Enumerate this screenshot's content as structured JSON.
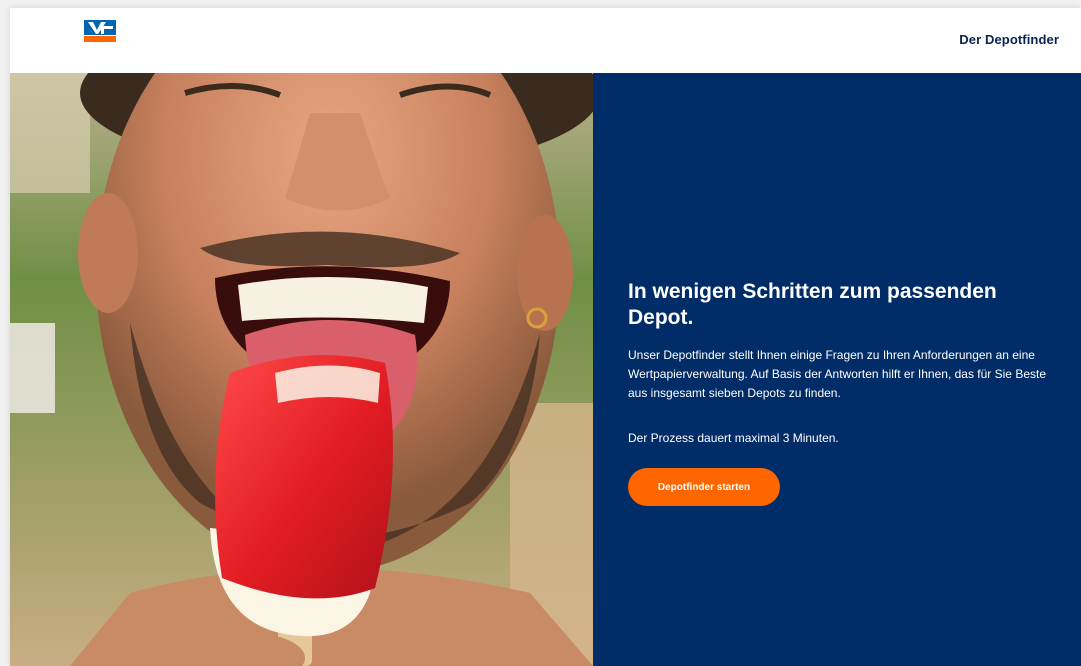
{
  "header": {
    "logo_icon": "volksbank-logo-icon",
    "title": "Der Depotfinder"
  },
  "hero": {
    "image_subject": "man-eating-popsicle-photo"
  },
  "panel": {
    "headline": "In wenigen Schritten zum passenden Depot.",
    "body": "Unser Depotfinder stellt Ihnen einige Fragen zu Ihren Anforderungen an eine Wertpapierverwaltung. Auf Basis der Antworten hilft er Ihnen,  das für Sie Beste aus insgesamt sieben Depots zu finden.",
    "duration": "Der Prozess dauert maximal 3 Minuten.",
    "cta_label": "Depotfinder starten"
  },
  "colors": {
    "brand_blue": "#002d67",
    "accent_orange": "#ff6600",
    "header_text": "#0a2352"
  }
}
